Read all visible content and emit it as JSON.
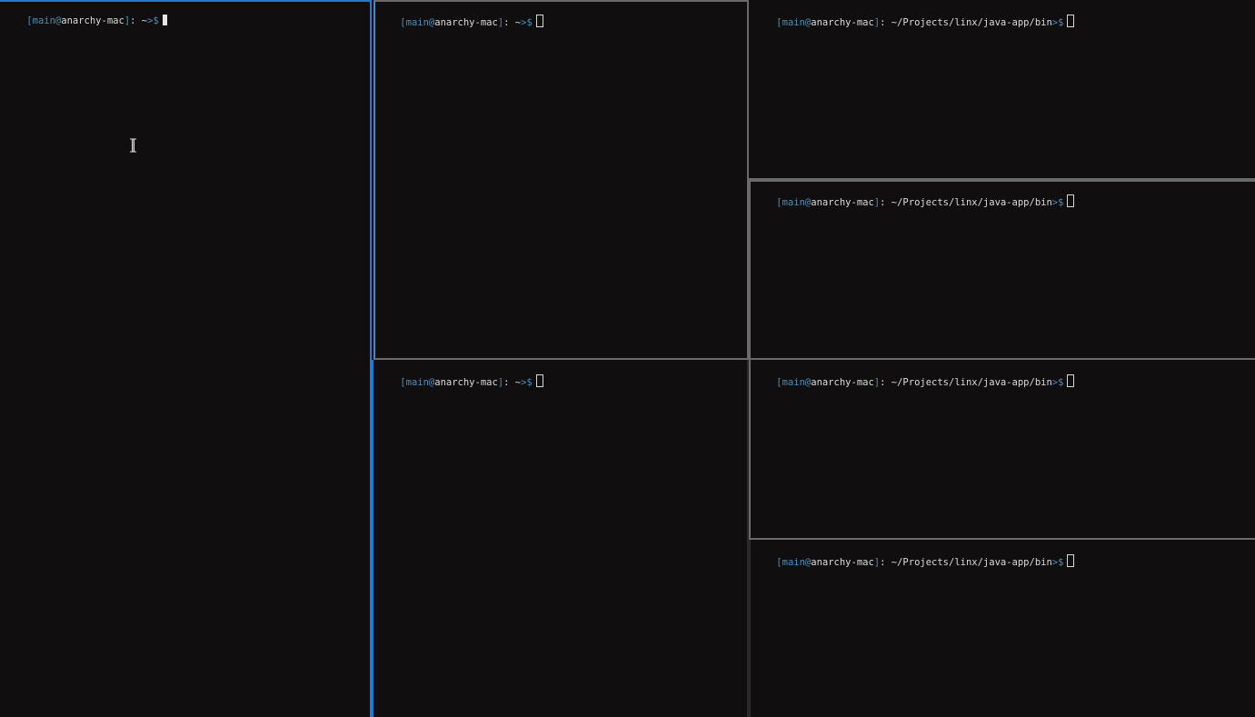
{
  "panes": [
    {
      "id": "left",
      "user": "main",
      "host": "anarchy-mac",
      "path": "~",
      "cursor": "solid",
      "focused": true
    },
    {
      "id": "mid-top",
      "user": "main",
      "host": "anarchy-mac",
      "path": "~",
      "cursor": "hollow",
      "focused": false
    },
    {
      "id": "mid-bottom",
      "user": "main",
      "host": "anarchy-mac",
      "path": "~",
      "cursor": "hollow",
      "focused": false
    },
    {
      "id": "right-1",
      "user": "main",
      "host": "anarchy-mac",
      "path": "~/Projects/linx/java-app/bin",
      "cursor": "hollow",
      "focused": false
    },
    {
      "id": "right-2",
      "user": "main",
      "host": "anarchy-mac",
      "path": "~/Projects/linx/java-app/bin",
      "cursor": "hollow",
      "focused": false
    },
    {
      "id": "right-3",
      "user": "main",
      "host": "anarchy-mac",
      "path": "~/Projects/linx/java-app/bin",
      "cursor": "hollow",
      "focused": false
    },
    {
      "id": "right-4",
      "user": "main",
      "host": "anarchy-mac",
      "path": "~/Projects/linx/java-app/bin",
      "cursor": "hollow",
      "focused": false
    }
  ],
  "prompt_tokens": {
    "open": "[",
    "at": "@",
    "close": "]",
    "colon": ": ",
    "arrow": ">",
    "dollar": "$"
  },
  "colors": {
    "background": "#100e0f",
    "focus_border": "#1f7bd0",
    "inactive_border": "#6a6a6a",
    "accent": "#4d8fb8",
    "text": "#dcdcdc"
  },
  "pointer": "text-cursor-icon"
}
